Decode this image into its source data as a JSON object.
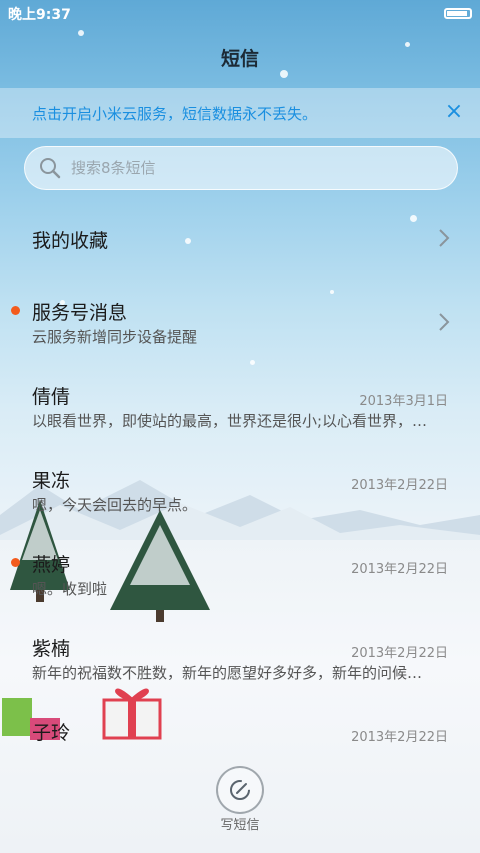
{
  "status": {
    "time": "晚上9:37"
  },
  "header": {
    "title": "短信"
  },
  "banner": {
    "text": "点击开启小米云服务，短信数据永不丢失。"
  },
  "search": {
    "placeholder": "搜索8条短信"
  },
  "list": [
    {
      "name": "我的收藏",
      "chevron": true
    },
    {
      "name": "服务号消息",
      "preview": "云服务新增同步设备提醒",
      "unread": true,
      "chevron": true
    },
    {
      "name": "倩倩",
      "date": "2013年3月1日",
      "preview": "以眼看世界，即使站的最高，世界还是很小;以心看世界，…"
    },
    {
      "name": "果冻",
      "date": "2013年2月22日",
      "preview": "嗯，今天会回去的早点。"
    },
    {
      "name": "燕婷",
      "date": "2013年2月22日",
      "preview": "嗯。收到啦",
      "unread": true
    },
    {
      "name": "紫楠",
      "date": "2013年2月22日",
      "preview": "新年的祝福数不胜数，新年的愿望好多好多，新年的问候…"
    },
    {
      "name": "子玲",
      "date": "2013年2月22日",
      "preview": ""
    }
  ],
  "compose": {
    "label": "写短信"
  },
  "colors": {
    "accent": "#1a8fe0",
    "unread_dot": "#f35b1d"
  }
}
